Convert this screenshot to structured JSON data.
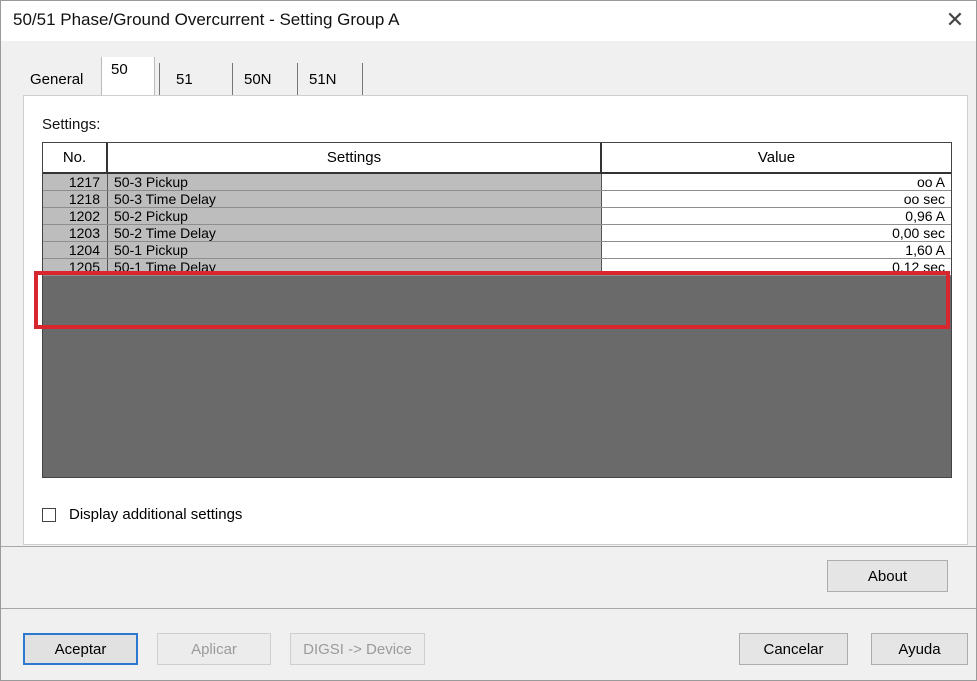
{
  "window": {
    "title": "50/51 Phase/Ground Overcurrent - Setting Group A",
    "close_glyph": "✕"
  },
  "tabs": [
    {
      "label": "General"
    },
    {
      "label": "50",
      "active": true
    },
    {
      "label": "51"
    },
    {
      "label": "50N"
    },
    {
      "label": "51N"
    }
  ],
  "settings_label": "Settings:",
  "grid": {
    "columns": [
      "No.",
      "Settings",
      "Value"
    ],
    "rows": [
      {
        "no": "1217",
        "setting": "50-3 Pickup",
        "value": "oo A"
      },
      {
        "no": "1218",
        "setting": "50-3 Time Delay",
        "value": "oo sec"
      },
      {
        "no": "1202",
        "setting": "50-2 Pickup",
        "value": "0,96 A"
      },
      {
        "no": "1203",
        "setting": "50-2 Time Delay",
        "value": "0,00 sec"
      },
      {
        "no": "1204",
        "setting": "50-1 Pickup",
        "value": "1,60 A"
      },
      {
        "no": "1205",
        "setting": "50-1 Time Delay",
        "value": "0,12 sec"
      }
    ],
    "highlight_color": "#d7262e"
  },
  "checkbox": {
    "label": "Display additional settings",
    "checked": false
  },
  "buttons": {
    "about": "About",
    "accept": "Aceptar",
    "apply": "Aplicar",
    "digsi": "DIGSI -> Device",
    "cancel": "Cancelar",
    "help": "Ayuda"
  }
}
